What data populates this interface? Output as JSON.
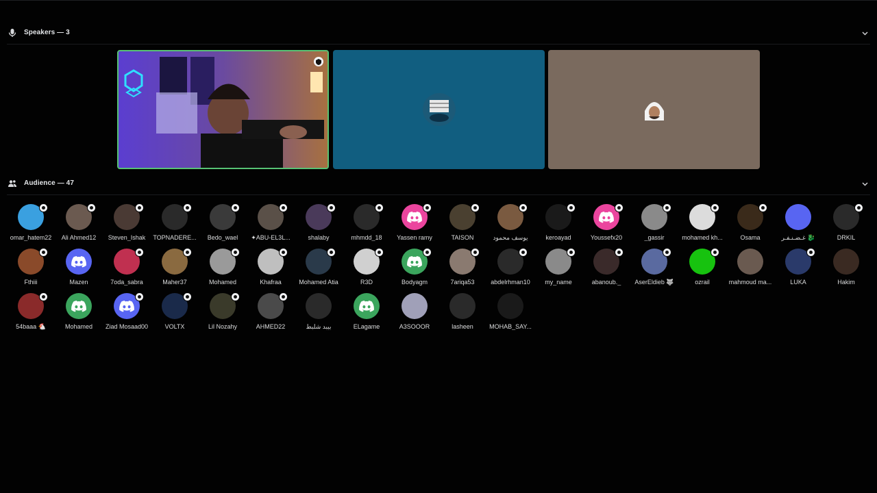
{
  "speakers": {
    "title": "Speakers — 3",
    "tiles": [
      {
        "kind": "video"
      },
      {
        "kind": "avatar",
        "bg": "#115e80"
      },
      {
        "kind": "avatar",
        "bg": "#7a6a5e"
      }
    ]
  },
  "audience": {
    "title": "Audience — 47",
    "members": [
      {
        "name": "omar_hatem22",
        "color": "#3aa0e0",
        "muted": true
      },
      {
        "name": "Ali Ahmed12",
        "color": "#6b5a50",
        "muted": true
      },
      {
        "name": "Steven_Ishak",
        "color": "#4a3a34",
        "muted": true
      },
      {
        "name": "TOPNADERE...",
        "color": "#2a2a2a",
        "muted": true
      },
      {
        "name": "Bedo_wael",
        "color": "#3a3a3a",
        "muted": true
      },
      {
        "name": "✦ABU-EL3L...",
        "color": "#5a5048",
        "muted": true
      },
      {
        "name": "shalaby",
        "color": "#4a3a5a",
        "muted": true
      },
      {
        "name": "mhmdd_18",
        "color": "#2a2a2a",
        "muted": true
      },
      {
        "name": "Yassen ramy",
        "color": "#eb459e",
        "muted": true,
        "discord": true
      },
      {
        "name": "TAISON",
        "color": "#4a4030",
        "muted": true
      },
      {
        "name": "يوسف محمود",
        "color": "#7a5a40",
        "muted": true
      },
      {
        "name": "keroayad",
        "color": "#1a1a1a",
        "muted": true
      },
      {
        "name": "Youssefx20",
        "color": "#eb459e",
        "muted": true,
        "discord": true
      },
      {
        "name": "_gassir",
        "color": "#8a8a8a",
        "muted": true
      },
      {
        "name": "mohamed kh...",
        "color": "#dcdcdc",
        "muted": true
      },
      {
        "name": "Osama",
        "color": "#3a2a1a",
        "muted": true
      },
      {
        "name": "غـضـنـفـر 🐉",
        "color": "#5865f2",
        "muted": false
      },
      {
        "name": "DRKIL",
        "color": "#2a2a2a",
        "muted": true
      },
      {
        "name": "Fthiii",
        "color": "#8a4a2a",
        "muted": true
      },
      {
        "name": "Mazen",
        "color": "#5865f2",
        "muted": false,
        "discord": true
      },
      {
        "name": "7oda_sabra",
        "color": "#c03050",
        "muted": true
      },
      {
        "name": "Maher37",
        "color": "#8a6a40",
        "muted": true
      },
      {
        "name": "Mohamed",
        "color": "#9a9a9a",
        "muted": true
      },
      {
        "name": "Khafraa",
        "color": "#bfbfbf",
        "muted": true
      },
      {
        "name": "Mohamed Atia",
        "color": "#2a3a4a",
        "muted": true
      },
      {
        "name": "R3D",
        "color": "#d0d0d0",
        "muted": true
      },
      {
        "name": "Bodyagm",
        "color": "#3ba55d",
        "muted": true,
        "discord": true
      },
      {
        "name": "7ariqa53",
        "color": "#8a7a70",
        "muted": true
      },
      {
        "name": "abdelrhman10",
        "color": "#2a2a2a",
        "muted": true
      },
      {
        "name": "my_name",
        "color": "#8a8a8a",
        "muted": true
      },
      {
        "name": "abanoub._",
        "color": "#3a2a2a",
        "muted": true
      },
      {
        "name": "AserEldieb 🐺",
        "color": "#5a6aa0",
        "muted": true
      },
      {
        "name": "ozrail",
        "color": "#17c20f",
        "muted": true
      },
      {
        "name": "mahmoud ma...",
        "color": "#6a5a50",
        "muted": false
      },
      {
        "name": "LUKA",
        "color": "#2a3a6a",
        "muted": true
      },
      {
        "name": "Hakim",
        "color": "#3a2a22",
        "muted": false
      },
      {
        "name": "54baaa 🐔",
        "color": "#8a2a2a",
        "muted": true
      },
      {
        "name": "Mohamed",
        "color": "#3ba55d",
        "muted": false,
        "discord": true
      },
      {
        "name": "Ziad Mosaad00",
        "color": "#5865f2",
        "muted": true,
        "discord": true
      },
      {
        "name": "VOLTX",
        "color": "#1a2a4a",
        "muted": true
      },
      {
        "name": "Lil Nozahy",
        "color": "#3a3a2a",
        "muted": true
      },
      {
        "name": "AHMED22",
        "color": "#4a4a4a",
        "muted": true
      },
      {
        "name": "بيبد شلبط",
        "color": "#2a2a2a",
        "muted": false
      },
      {
        "name": "ELagame",
        "color": "#3ba55d",
        "muted": false,
        "discord": true
      },
      {
        "name": "A3SOOOR",
        "color": "#a0a0b8",
        "muted": false
      },
      {
        "name": "lasheen",
        "color": "#2a2a2a",
        "muted": false
      },
      {
        "name": "MOHAB_SAY...",
        "color": "#1a1a1a",
        "muted": false
      }
    ]
  }
}
